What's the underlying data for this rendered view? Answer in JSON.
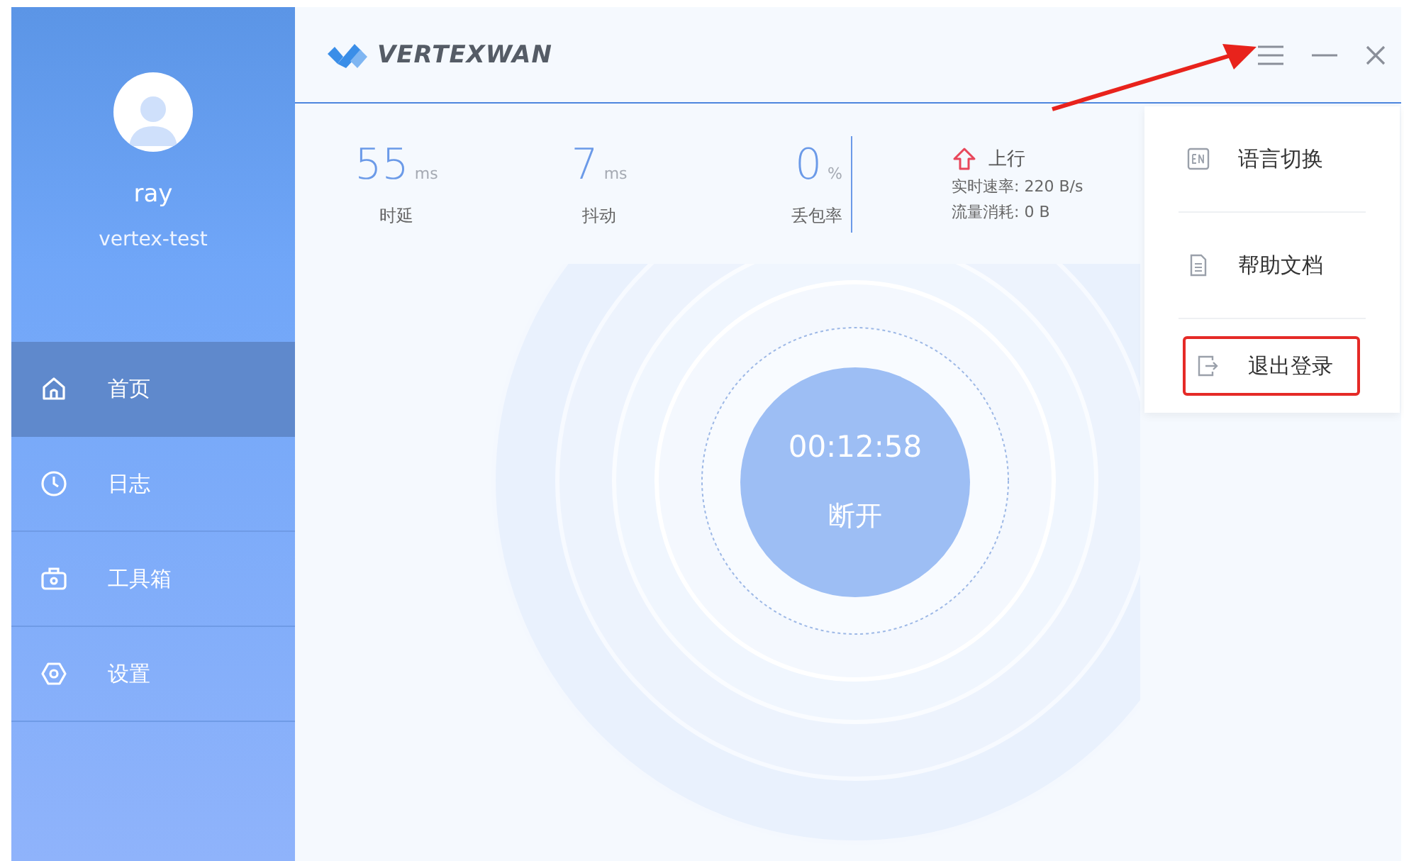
{
  "user": {
    "name": "ray",
    "account": "vertex-test"
  },
  "nav": [
    {
      "label": "首页",
      "kind": "home",
      "selected": true
    },
    {
      "label": "日志",
      "kind": "clock",
      "selected": false
    },
    {
      "label": "工具箱",
      "kind": "toolbox",
      "selected": false
    },
    {
      "label": "设置",
      "kind": "settings",
      "selected": false
    }
  ],
  "brand": "VERTEXWAN",
  "stats": [
    {
      "value": "55",
      "unit": "ms",
      "label": "时延"
    },
    {
      "value": "7",
      "unit": "ms",
      "label": "抖动"
    },
    {
      "value": "0",
      "unit": "%",
      "label": "丢包率"
    }
  ],
  "upload": {
    "title": "上行",
    "rate": "实时速率: 220 B/s",
    "usage": "流量消耗: 0 B"
  },
  "connection": {
    "timer": "00:12:58",
    "action": "断开"
  },
  "menu": [
    {
      "label": "语言切换",
      "kind": "language",
      "highlighted": false
    },
    {
      "label": "帮助文档",
      "kind": "doc",
      "highlighted": false
    },
    {
      "label": "退出登录",
      "kind": "logout",
      "highlighted": true
    }
  ]
}
